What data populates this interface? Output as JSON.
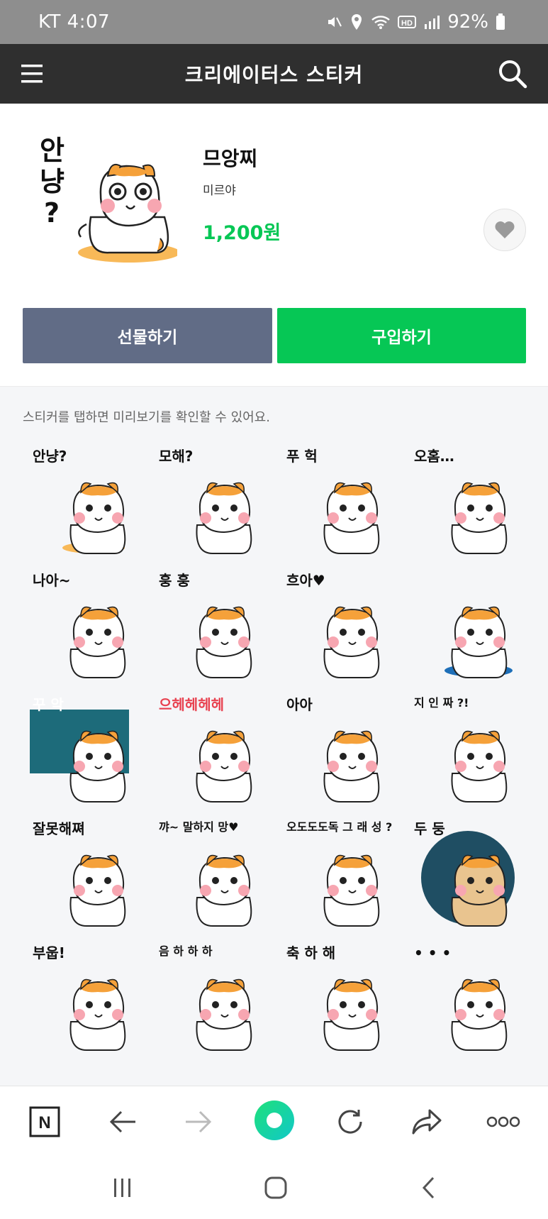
{
  "status_bar": {
    "carrier_time": "KT 4:07",
    "battery": "92%",
    "icons": [
      "mute-icon",
      "location-icon",
      "wifi-icon",
      "hd-icon",
      "signal-icon",
      "battery-icon"
    ]
  },
  "header": {
    "title": "크리에이터스 스티커",
    "menu_icon": "menu-icon",
    "search_icon": "search-icon"
  },
  "product": {
    "name": "므앙찌",
    "author": "미르야",
    "price": "1,200원",
    "main_sticker_text": [
      "안",
      "냥",
      "?"
    ],
    "gift_label": "선물하기",
    "buy_label": "구입하기",
    "favorite_icon": "heart-icon"
  },
  "hint": "스티커를 탭하면 미리보기를 확인할 수 있어요.",
  "stickers": [
    {
      "text": "안냥?"
    },
    {
      "text": "모해?"
    },
    {
      "text": "푸 헉"
    },
    {
      "text": "오홈…"
    },
    {
      "text": "나아~"
    },
    {
      "text": "훙 훙"
    },
    {
      "text": "흐아♥"
    },
    {
      "text": ""
    },
    {
      "text": "꾸 악"
    },
    {
      "text": "으헤헤헤헤"
    },
    {
      "text": "아아"
    },
    {
      "text": "지 인 짜 ?!"
    },
    {
      "text": "잘못해쪄"
    },
    {
      "text": "꺄~ 말하지 망♥"
    },
    {
      "text": "오도도도독 그 래 성 ?"
    },
    {
      "text": "두 둥"
    },
    {
      "text": "부웁!"
    },
    {
      "text": "음 하 하 하"
    },
    {
      "text": "축 하 해"
    },
    {
      "text": "• • •"
    }
  ],
  "toolbar": {
    "items": [
      "naver-icon",
      "back-arrow-icon",
      "forward-arrow-icon",
      "green-dot-icon",
      "refresh-icon",
      "share-icon",
      "more-icon"
    ],
    "naver_label": "N"
  },
  "system_nav": [
    "recent-apps-icon",
    "home-icon",
    "back-icon"
  ],
  "colors": {
    "header_bg": "#2f2f2f",
    "status_bg": "#8e8e8e",
    "buy": "#06c755",
    "gift": "#616c86",
    "price": "#06c755",
    "hamster_orange": "#f5a13a",
    "blush": "#f7a6b1"
  }
}
